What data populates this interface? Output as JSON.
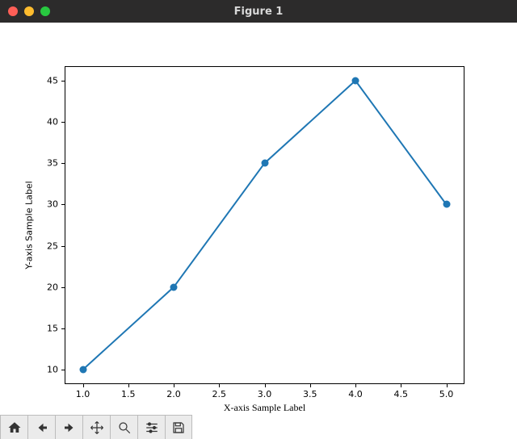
{
  "window": {
    "title": "Figure 1"
  },
  "chart_data": {
    "type": "line",
    "x": [
      1.0,
      2.0,
      3.0,
      4.0,
      5.0
    ],
    "y": [
      10,
      20,
      35,
      45,
      30
    ],
    "xlabel": "X-axis Sample Label",
    "ylabel": "Y-axis Sample Label",
    "xlabel_font": "Lucida Calligraphy",
    "xticks": [
      1.0,
      1.5,
      2.0,
      2.5,
      3.0,
      3.5,
      4.0,
      4.5,
      5.0
    ],
    "xtick_labels": [
      "1.0",
      "1.5",
      "2.0",
      "2.5",
      "3.0",
      "3.5",
      "4.0",
      "4.5",
      "5.0"
    ],
    "yticks": [
      10,
      15,
      20,
      25,
      30,
      35,
      40,
      45
    ],
    "ytick_labels": [
      "10",
      "15",
      "20",
      "25",
      "30",
      "35",
      "40",
      "45"
    ],
    "xlim": [
      0.8,
      5.2
    ],
    "ylim": [
      8.25,
      46.75
    ],
    "line_color": "#1f77b4",
    "markers": true
  },
  "toolbar": {
    "items": [
      {
        "name": "home",
        "label": "Home"
      },
      {
        "name": "back",
        "label": "Back"
      },
      {
        "name": "forward",
        "label": "Forward"
      },
      {
        "name": "pan",
        "label": "Pan"
      },
      {
        "name": "zoom",
        "label": "Zoom"
      },
      {
        "name": "configure",
        "label": "Configure subplots"
      },
      {
        "name": "save",
        "label": "Save"
      }
    ]
  }
}
